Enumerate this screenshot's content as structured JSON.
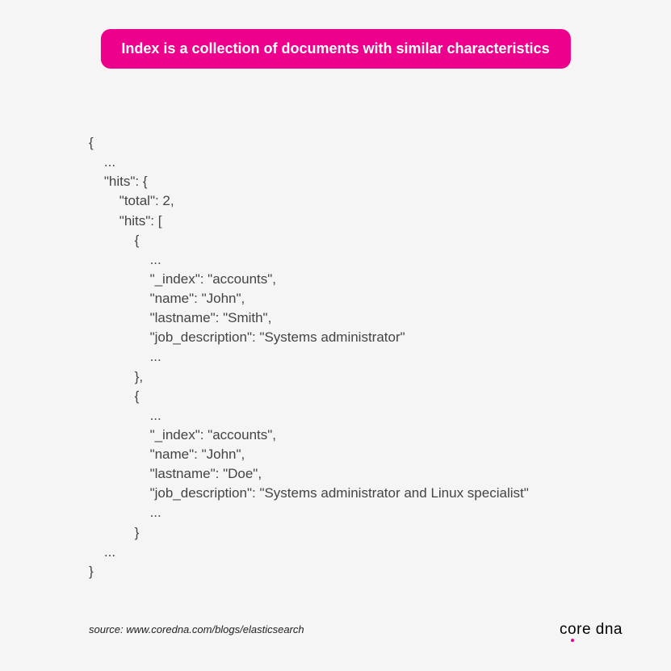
{
  "banner": "Index is a collection of documents with similar characteristics",
  "code": "{\n    ...\n    \"hits\": {\n        \"total\": 2,\n        \"hits\": [\n            {\n                ...\n                \"_index\": \"accounts\",\n                \"name\": \"John\",\n                \"lastname\": \"Smith\",\n                \"job_description\": \"Systems administrator\"\n                ...\n            },\n            {\n                ...\n                \"_index\": \"accounts\",\n                \"name\": \"John\",\n                \"lastname\": \"Doe\",\n                \"job_description\": \"Systems administrator and Linux specialist\"\n                ...\n            }\n    ...\n}",
  "source": "source: www.coredna.com/blogs/elasticsearch",
  "logo_text": "core dna"
}
